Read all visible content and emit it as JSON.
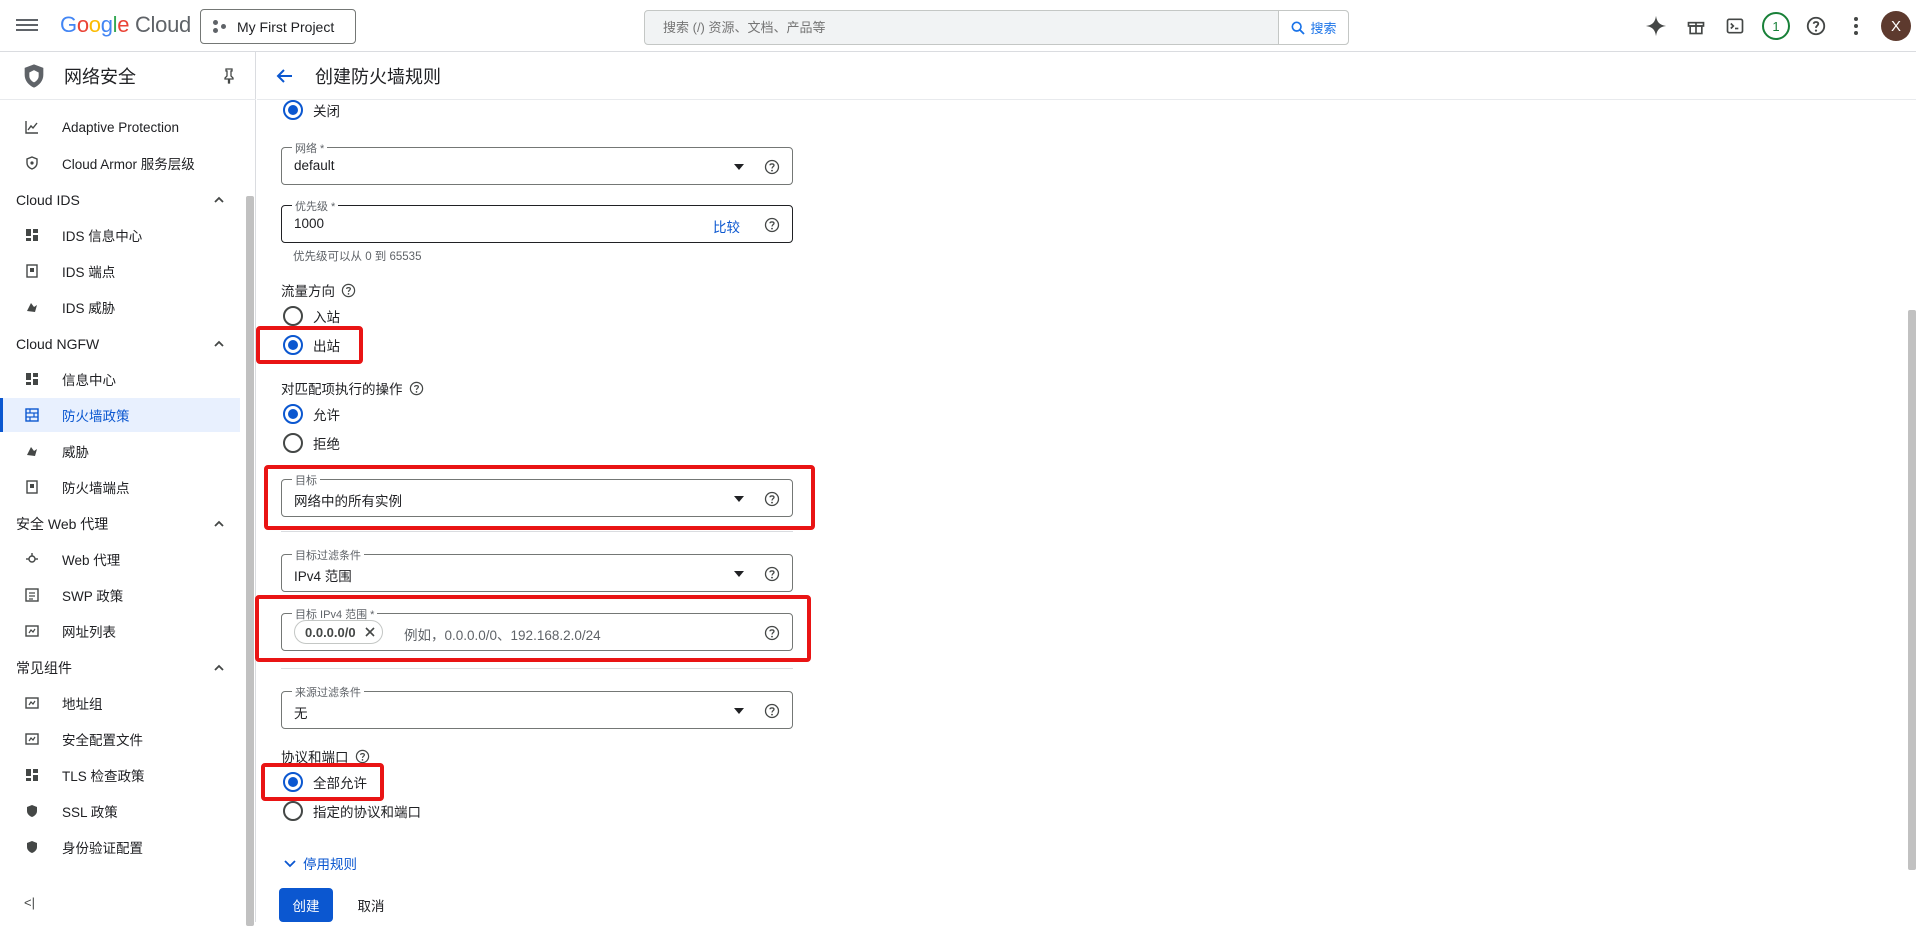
{
  "topbar": {
    "logo_google": [
      "G",
      "o",
      "o",
      "g",
      "l",
      "e"
    ],
    "logo_cloud": "Cloud",
    "project": "My First Project",
    "search_placeholder": "搜索 (/) 资源、文档、产品等",
    "search_button": "搜索",
    "notification_count": "1",
    "avatar_letter": "X"
  },
  "sidebar": {
    "title": "网络安全",
    "items_top": [
      {
        "label": "Adaptive Protection"
      },
      {
        "label": "Cloud Armor 服务层级"
      }
    ],
    "section_ids": {
      "label": "Cloud IDS",
      "items": [
        "IDS 信息中心",
        "IDS 端点",
        "IDS 威胁"
      ]
    },
    "section_ngfw": {
      "label": "Cloud NGFW",
      "items": [
        "信息中心",
        "防火墙政策",
        "威胁",
        "防火墙端点"
      ]
    },
    "section_swp": {
      "label": "安全 Web 代理",
      "items": [
        "Web 代理",
        "SWP 政策",
        "网址列表"
      ]
    },
    "section_common": {
      "label": "常见组件",
      "items": [
        "地址组",
        "安全配置文件",
        "TLS 检查政策",
        "SSL 政策",
        "身份验证配置"
      ]
    },
    "collapse": "<|"
  },
  "page": {
    "title": "创建防火墙规则",
    "logs_off": "关闭",
    "network": {
      "label": "网络 *",
      "value": "default"
    },
    "priority": {
      "label": "优先级 *",
      "value": "1000",
      "compare": "比较",
      "hint": "优先级可以从 0 到 65535"
    },
    "direction": {
      "label": "流量方向",
      "ingress": "入站",
      "egress": "出站"
    },
    "action": {
      "label": "对匹配项执行的操作",
      "allow": "允许",
      "deny": "拒绝"
    },
    "target": {
      "label": "目标",
      "value": "网络中的所有实例"
    },
    "dest_filter": {
      "label": "目标过滤条件",
      "value": "IPv4 范围"
    },
    "dest_ranges": {
      "label": "目标 IPv4 范围 *",
      "chip": "0.0.0.0/0",
      "placeholder": "例如，0.0.0.0/0、192.168.2.0/24"
    },
    "source_filter": {
      "label": "来源过滤条件",
      "value": "无"
    },
    "protocols": {
      "label": "协议和端口",
      "allow_all": "全部允许",
      "specified": "指定的协议和端口"
    },
    "disable_rule": "停用规则",
    "create": "创建",
    "cancel": "取消"
  },
  "colors": {
    "accent": "#0b57d0",
    "highlight": "#e91414"
  }
}
